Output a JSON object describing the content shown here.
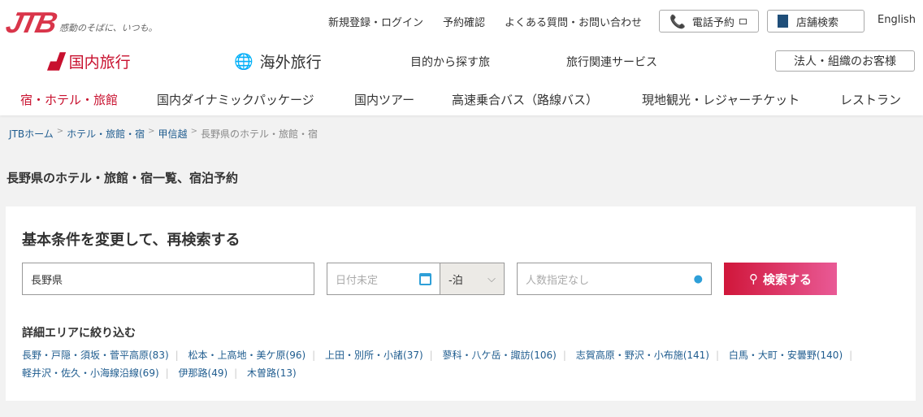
{
  "header": {
    "logo": "JTB",
    "tagline": "感動のそばに、いつも。",
    "top_links": [
      "新規登録・ログイン",
      "予約確認",
      "よくある質問・お問い合わせ"
    ],
    "phone_button": "電話予約",
    "store_button": "店舗検索",
    "english": "English",
    "domestic": "国内旅行",
    "overseas": "海外旅行",
    "purpose": "目的から探す旅",
    "services": "旅行関連サービス",
    "corporate": "法人・組織のお客様",
    "categories": [
      "宿・ホテル・旅館",
      "国内ダイナミックパッケージ",
      "国内ツアー",
      "高速乗合バス（路線バス）",
      "現地観光・レジャーチケット",
      "レストラン"
    ],
    "accent": "#c8102e"
  },
  "breadcrumb": [
    "JTBホーム",
    "ホテル・旅館・宿",
    "甲信越",
    "長野県のホテル・旅館・宿"
  ],
  "page_title": "長野県のホテル・旅館・宿一覧、宿泊予約",
  "search": {
    "title": "基本条件を変更して、再検索する",
    "destination": "長野県",
    "date_placeholder": "日付未定",
    "nights": "-泊",
    "guests_placeholder": "人数指定なし",
    "button": "検索する"
  },
  "areas": {
    "title": "詳細エリアに絞り込む",
    "items": [
      "長野・戸隠・須坂・菅平高原(83)",
      "松本・上高地・美ケ原(96)",
      "上田・別所・小諸(37)",
      "蓼科・八ケ岳・諏訪(106)",
      "志賀高原・野沢・小布施(141)",
      "白馬・大町・安曇野(140)",
      "軽井沢・佐久・小海線沿線(69)",
      "伊那路(49)",
      "木曽路(13)"
    ]
  }
}
